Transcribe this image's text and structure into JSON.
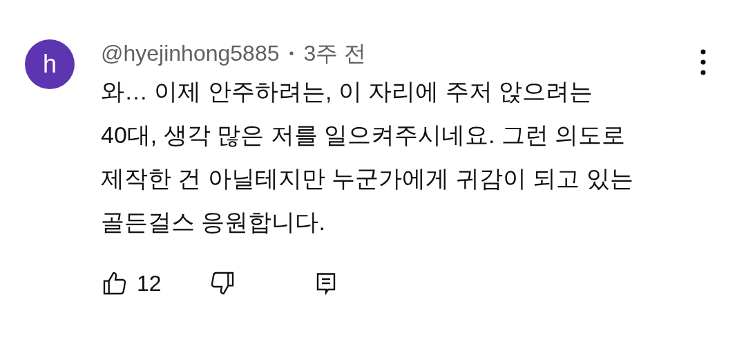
{
  "comment": {
    "avatar_letter": "h",
    "author": "@hyejinhong5885",
    "separator": "•",
    "time": "3주 전",
    "text_lines": [
      "와… 이제 안주하려는, 이 자리에 주저 앉으려는",
      "40대, 생각 많은 저를 일으켜주시네요. 그런 의도로",
      "제작한 건 아닐테지만 누군가에게 귀감이 되고 있는",
      "골든걸스 응원합니다."
    ],
    "like_count": "12"
  }
}
